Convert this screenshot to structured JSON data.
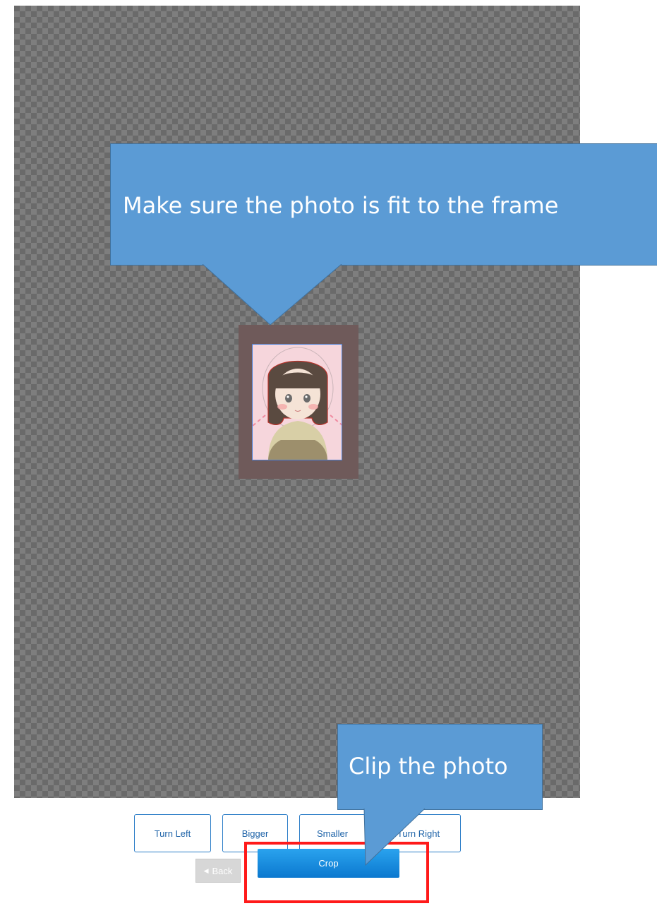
{
  "editor": {
    "callouts": {
      "frame_hint": "Make sure the photo is fit to the frame",
      "clip_hint": "Clip the photo"
    },
    "buttons": {
      "turn_left": "Turn Left",
      "bigger": "Bigger",
      "smaller": "Smaller",
      "turn_right": "Turn Right",
      "back": "Back",
      "back_icon": "chevron-left-icon",
      "crop": "Crop"
    },
    "colors": {
      "callout_fill": "#5b9bd5",
      "primary_button": "#1488dd",
      "highlight": "#ff1a1a",
      "frame_border": "#4a7fd6"
    }
  }
}
